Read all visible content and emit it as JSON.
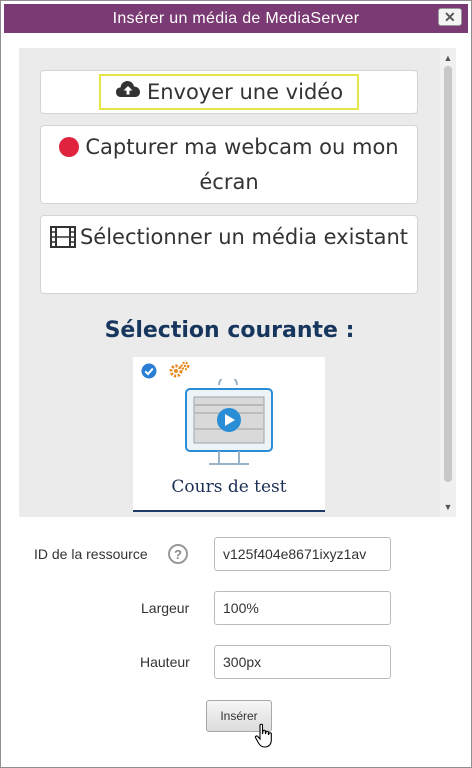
{
  "dialog": {
    "title": "Insérer un média de MediaServer",
    "close_glyph": "✕"
  },
  "options": {
    "upload_label": "Envoyer une vidéo",
    "upload_icon": "cloud-upload-icon",
    "webcam_label": "Capturer ma webcam ou mon écran",
    "webcam_icon": "record-dot-icon",
    "webcam_icon_color": "#e0233f",
    "select_label": "Sélectionner un média existant",
    "select_icon": "film-icon"
  },
  "selection": {
    "heading": "Sélection courante :",
    "media_title": "Cours de test",
    "badges": [
      "check-circle-icon",
      "gears-icon"
    ],
    "accent_color": "#2a7fd4",
    "badge_gear_color": "#e8891c"
  },
  "form": {
    "resource_id_label": "ID de la ressource",
    "resource_id_value": "v125f404e8671ixyz1av",
    "width_label": "Largeur",
    "width_value": "100%",
    "height_label": "Hauteur",
    "height_value": "300px"
  },
  "actions": {
    "insert_label": "Insérer"
  },
  "colors": {
    "titlebar": "#7a3a73",
    "heading": "#17365e",
    "focus_outline": "#e6e64a"
  }
}
